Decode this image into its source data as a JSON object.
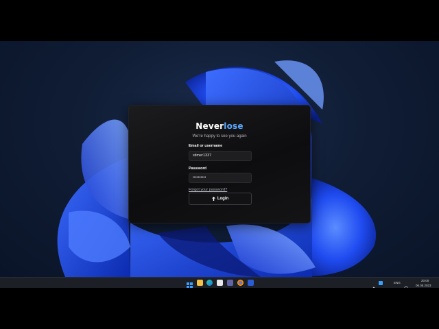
{
  "dialog": {
    "brand_part1": "Never",
    "brand_part2": "lose",
    "subtitle": "We're happy to see you again",
    "email_label": "Email or username",
    "email_value": "stimer1337",
    "password_label": "Password",
    "password_value": "••••••••••",
    "forgot_link": "Forgot your password?",
    "login_label": "Login"
  },
  "taskbar": {
    "apps": [
      "start-icon",
      "search-icon",
      "file-explorer-icon",
      "edge-icon",
      "notepad-icon",
      "teams-icon",
      "chrome-icon",
      "app-icon"
    ],
    "language": "ENG",
    "time": "20:00",
    "date": "06.05.2023"
  },
  "colors": {
    "accent": "#5aa8ff",
    "dialog_bg": "#111113",
    "taskbar_bg": "#1c1f26"
  }
}
